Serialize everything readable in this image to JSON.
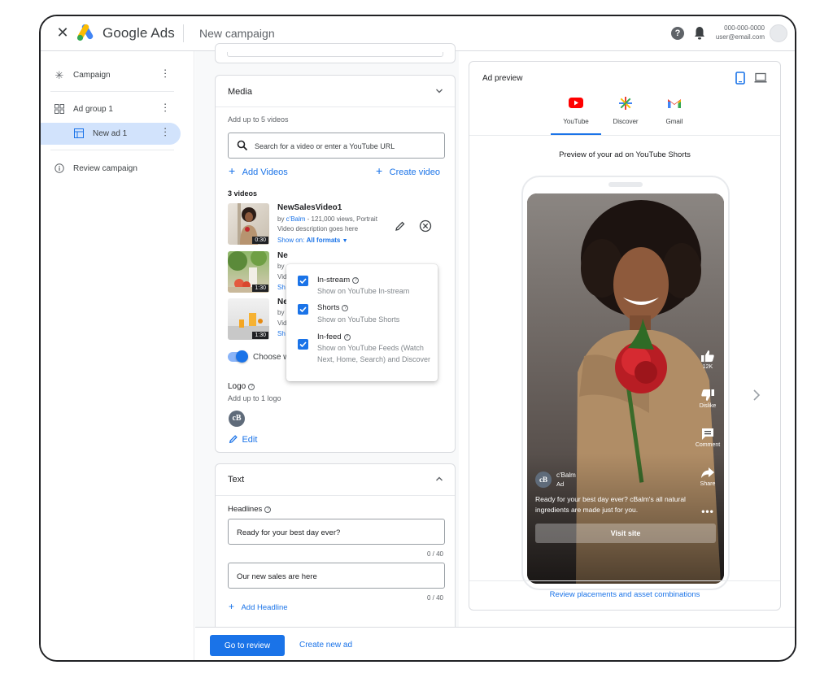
{
  "header": {
    "brand": "Google Ads",
    "page_title": "New campaign",
    "account_phone": "000-000-0000",
    "account_email": "user@email.com"
  },
  "sidebar": {
    "items": [
      {
        "label": "Campaign",
        "icon": "asterisk-icon"
      },
      {
        "label": "Ad group 1",
        "icon": "grid-icon"
      },
      {
        "label": "New ad 1",
        "icon": "table-icon",
        "active": true
      },
      {
        "label": "Review campaign",
        "icon": "info-icon"
      }
    ]
  },
  "media": {
    "title": "Media",
    "hint": "Add up to 5 videos",
    "search_placeholder": "Search for a video or enter a YouTube URL",
    "add_videos": "Add Videos",
    "create_video": "Create video",
    "count_label": "3 videos",
    "videos": [
      {
        "title": "NewSalesVideo1",
        "by_prefix": "by ",
        "channel": "c'Balm",
        "meta": " - 121,000 views, Portrait",
        "description": "Video description goes here",
        "show_on_label": "Show on:",
        "show_on_value": "All formats",
        "duration": "0:30"
      },
      {
        "title": "Ne",
        "by": "by",
        "desc": "Vid",
        "show": "Sh",
        "duration": "1:30"
      },
      {
        "title": "Ne",
        "by": "by",
        "desc": "Vid",
        "show": "Sh",
        "duration": "1:30"
      }
    ],
    "choose_label": "Choose w",
    "logo_title": "Logo",
    "logo_hint": "Add up to 1 logo",
    "logo_initials": "cB",
    "edit": "Edit"
  },
  "formats_popup": {
    "options": [
      {
        "title": "In-stream",
        "subtitle": "Show on YouTube In-stream",
        "checked": true
      },
      {
        "title": "Shorts",
        "subtitle": "Show on YouTube Shorts",
        "checked": true
      },
      {
        "title": "In-feed",
        "subtitle": "Show on YouTube Feeds (Watch Next, Home, Search) and Discover",
        "checked": true
      }
    ]
  },
  "text_section": {
    "title": "Text",
    "headlines_label": "Headlines",
    "headlines": [
      {
        "value": "Ready for your best day ever?",
        "count": "0 / 40"
      },
      {
        "value": "Our new sales are here",
        "count": "0 / 40"
      }
    ],
    "add_headline": "Add Headline"
  },
  "preview": {
    "title": "Ad preview",
    "tabs": [
      {
        "label": "YouTube",
        "icon": "youtube-icon",
        "active": true
      },
      {
        "label": "Discover",
        "icon": "discover-icon"
      },
      {
        "label": "Gmail",
        "icon": "gmail-icon"
      }
    ],
    "caption": "Preview of your ad on YouTube Shorts",
    "likes": "12K",
    "dislike": "Dislike",
    "comment": "Comment",
    "share": "Share",
    "channel": "c'Balm",
    "ad_label": "Ad",
    "ad_body": "Ready for your best day ever? cBalm's all natural ingredients are made just for you.",
    "cta": "Visit site",
    "review_link": "Review placements and asset combinations"
  },
  "footer": {
    "primary": "Go to review",
    "secondary": "Create new ad"
  },
  "colors": {
    "accent": "#1a73e8",
    "active_bg": "#d2e3fc",
    "youtube_red": "#ff0000"
  }
}
